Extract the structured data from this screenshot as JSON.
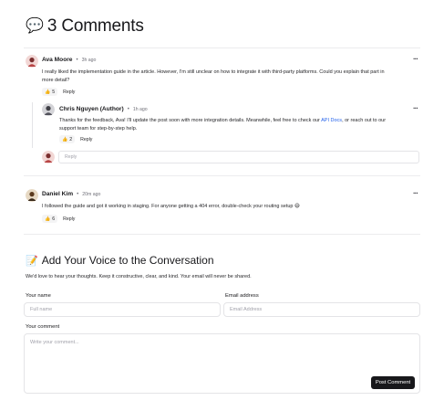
{
  "comments_heading": {
    "icon": "speech-bubble-icon",
    "emoji": "💬",
    "title": "3 Comments"
  },
  "comments": [
    {
      "author": "Ava Moore",
      "time": "3h ago",
      "body": "I really liked the implementation guide in the article. However, I'm still unclear on how to integrate it with third-party platforms. Could you explain that part in more detail?",
      "likes": "5",
      "reply_label": "Reply"
    },
    {
      "author": "Chris Nguyen (Author)",
      "time": "1h ago",
      "body_before_link": "Thanks for the feedback, Ava! I'll update the post soon with more integration details. Meanwhile, feel free to check our ",
      "link_text": "API Docs",
      "body_after_link": ", or reach out to our support team for step-by-step help.",
      "likes": "2",
      "reply_label": "Reply"
    },
    {
      "author": "Daniel Kim",
      "time": "20m ago",
      "body": "I followed the guide and got it working in staging. For anyone getting a 404 error, double-check your routing setup 😄",
      "likes": "6",
      "reply_label": "Reply"
    }
  ],
  "reply_input": {
    "placeholder": "Reply"
  },
  "form": {
    "icon": "memo-icon",
    "emoji": "📝",
    "title": "Add Your Voice to the Conversation",
    "description": "We'd love to hear your thoughts. Keep it constructive, clear, and kind. Your email will never be shared.",
    "name_label": "Your name",
    "name_placeholder": "Full name",
    "email_label": "Email address",
    "email_placeholder": "Email Address",
    "comment_label": "Your comment",
    "comment_placeholder": "Write your comment...",
    "submit_label": "Post Comment"
  },
  "colors": {
    "link": "#2563eb",
    "button_bg": "#18181b",
    "border": "#e4e4e7"
  }
}
